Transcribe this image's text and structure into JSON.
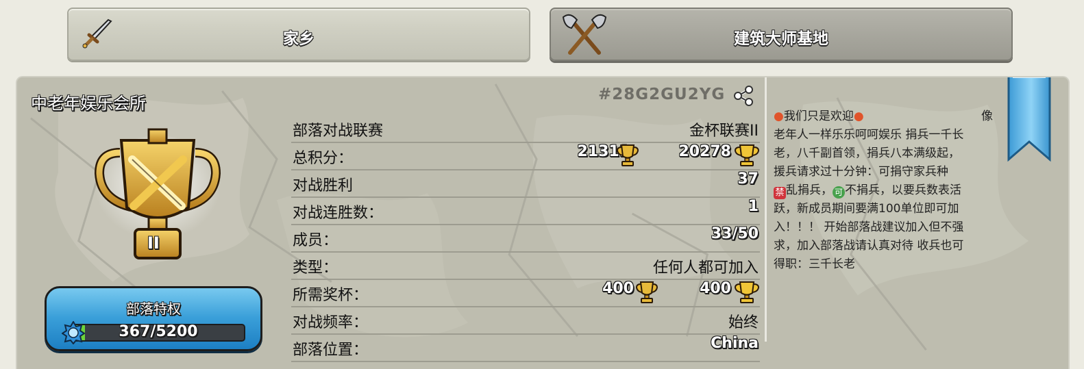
{
  "tabs": [
    {
      "label": "家乡",
      "icon": "sword-icon"
    },
    {
      "label": "建筑大师基地",
      "icon": "crossed-axes-icon"
    }
  ],
  "clan": {
    "name": "中老年娱乐会所",
    "tag": "#28G2GU2YG",
    "badge_level": "II",
    "colors": {
      "panel": "#bdbcae",
      "perks_blue": "#3a9fd9",
      "gold": "#e7b93a"
    }
  },
  "perks": {
    "label": "部落特权",
    "progress": "367/5200",
    "progress_fraction": 0.0706
  },
  "stats": {
    "war_league": {
      "label": "部落对战联赛",
      "value": "金杯联赛II"
    },
    "total_points": {
      "label": "总积分：",
      "home": "21311",
      "builder": "20278"
    },
    "war_wins": {
      "label": "对战胜利",
      "value": "37"
    },
    "win_streak": {
      "label": "对战连胜数：",
      "value": "1"
    },
    "members": {
      "label": "成员：",
      "value": "33/50"
    },
    "type": {
      "label": "类型：",
      "value": "任何人都可加入"
    },
    "required_trophies": {
      "label": "所需奖杯：",
      "home": "400",
      "builder": "400"
    },
    "war_frequency": {
      "label": "对战频率：",
      "value": "始终"
    },
    "location": {
      "label": "部落位置：",
      "value": "China"
    }
  },
  "description": {
    "line1_a": "我们只是欢迎",
    "line1_b": "像",
    "line2": "老年人一样乐乐呵呵娱乐  捐兵一千长",
    "line3": "老，八千副首领，捐兵八本满级起，",
    "line4": "援兵请求过十分钟：可捐守家兵种",
    "line5_stop": "禁",
    "line5_a": "乱捐兵，",
    "line5_ok": "可",
    "line5_b": "不捐兵，以要兵数表活",
    "line6": "跃，新成员期间要满100单位即可加",
    "line7": "入！！！ 开始部落战建议加入但不强",
    "line8": "求，加入部落战请认真对待  收兵也可",
    "line9": "得职：三千长老"
  }
}
